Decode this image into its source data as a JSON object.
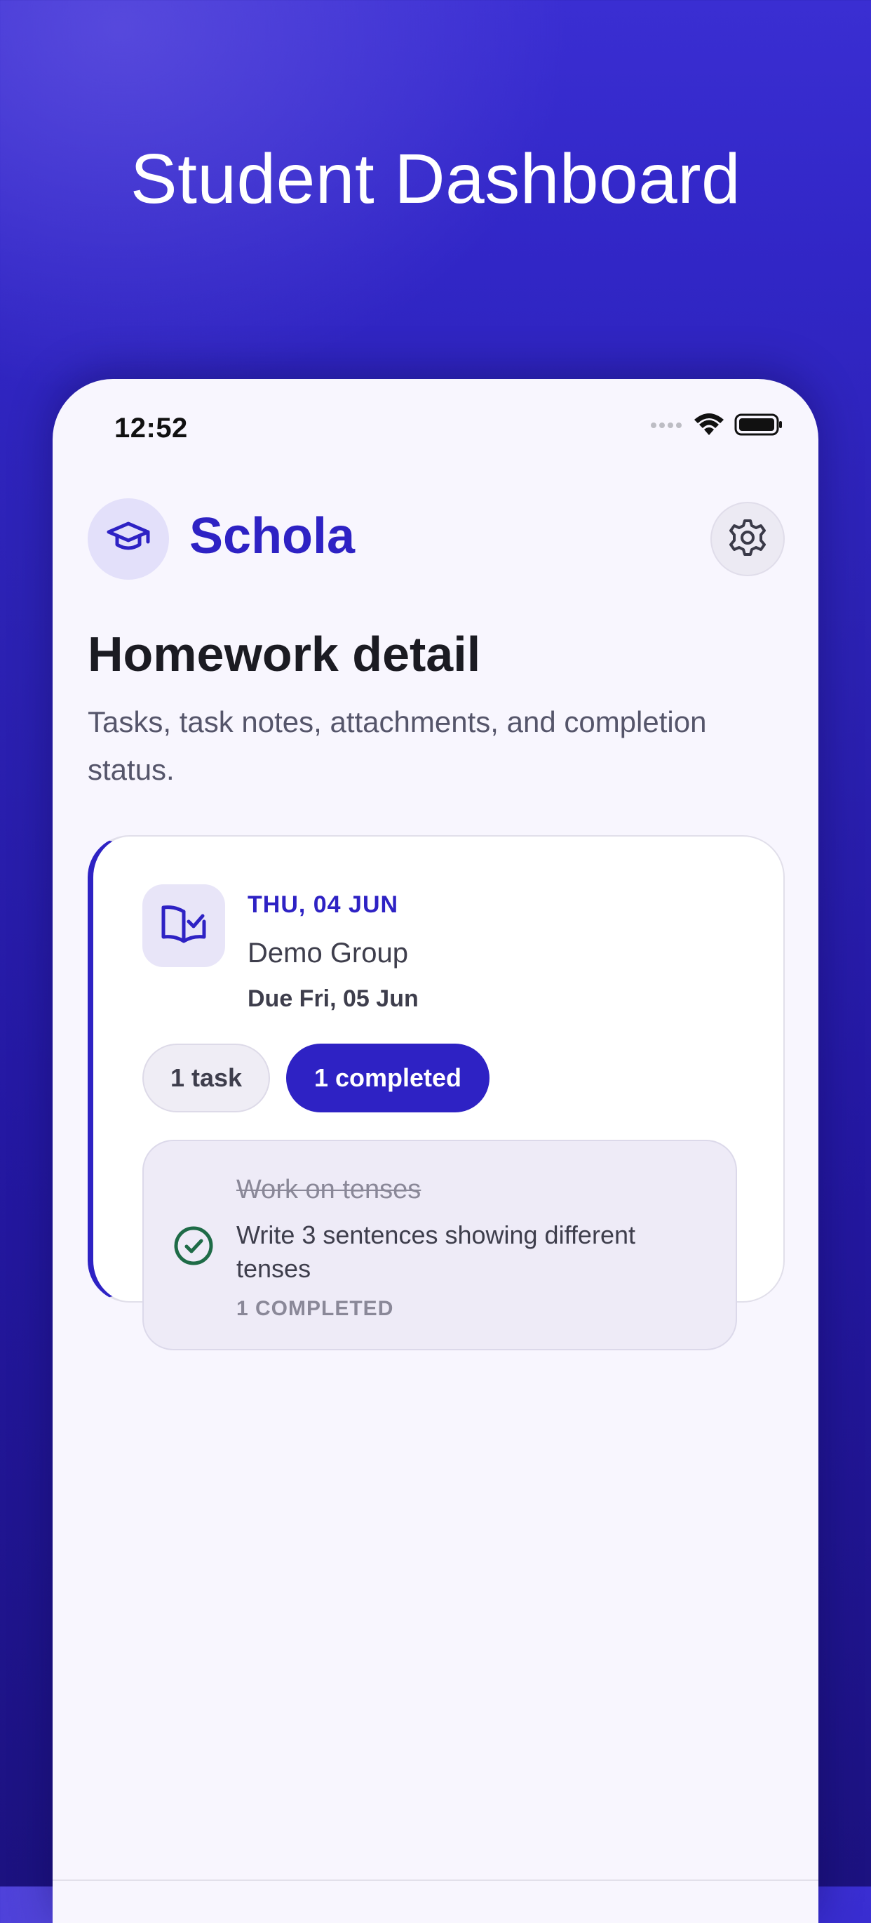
{
  "promo": {
    "title": "Student Dashboard"
  },
  "status_bar": {
    "time": "12:52",
    "icons": [
      "signal-dots-icon",
      "wifi-icon",
      "battery-icon"
    ]
  },
  "header": {
    "brand_icon": "graduation-cap-icon",
    "brand_name": "Schola",
    "settings_icon": "gear-icon"
  },
  "page": {
    "title": "Homework detail",
    "subtitle": "Tasks, task notes, attachments, and completion status."
  },
  "homework": {
    "icon": "book-check-icon",
    "date": "THU, 04 JUN",
    "group": "Demo Group",
    "due": "Due Fri, 05 Jun",
    "task_count_label": "1 task",
    "completed_label": "1 completed",
    "tasks": [
      {
        "title": "Work on tenses",
        "note": "Write 3 sentences showing different tenses",
        "status": "1 COMPLETED",
        "completed": true
      }
    ]
  },
  "colors": {
    "accent": "#2E22C4",
    "background_top": "#3A2ED2",
    "background_bottom": "#1C1280",
    "surface": "#F8F6FE",
    "success": "#1E6B47"
  }
}
